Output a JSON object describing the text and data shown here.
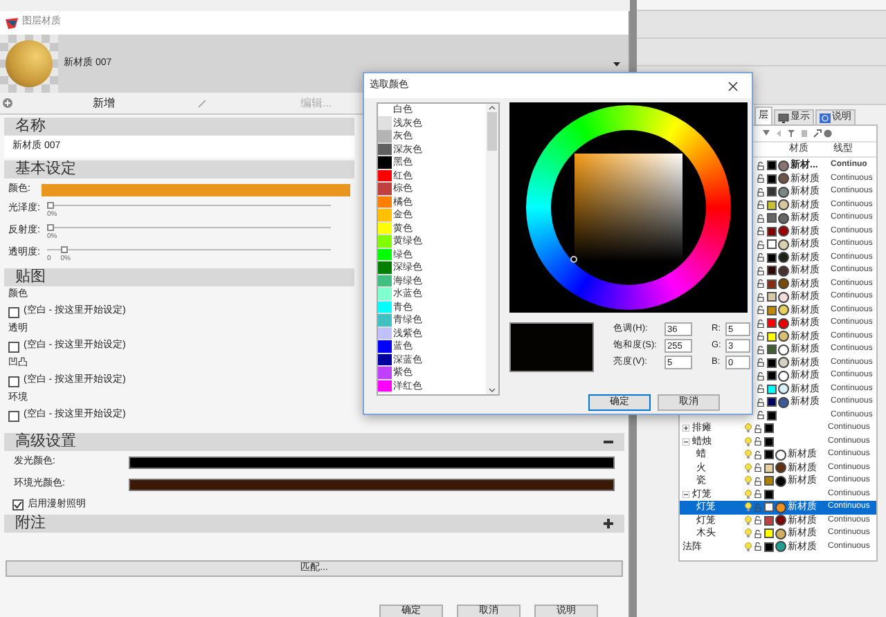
{
  "material_window": {
    "title": "图层材质",
    "material_name": "新材质 007",
    "toolbar": {
      "new": "新增",
      "edit": "编辑..."
    },
    "name_section": {
      "title": "名称",
      "value": "新材质 007"
    },
    "basic": {
      "title": "基本设定",
      "color_rows": [
        {
          "label": "颜色:",
          "color": "#e8961e"
        }
      ],
      "sliders": [
        {
          "label": "光泽度:",
          "level": 0,
          "reading": "0%"
        },
        {
          "label": "反射度:",
          "level": 0,
          "reading": "0%"
        },
        {
          "label": "透明度:",
          "level": 0.05,
          "reading": "0%",
          "min_label": "0"
        }
      ]
    },
    "textures": {
      "title": "贴图",
      "slots": [
        {
          "label": "颜色",
          "checked": false,
          "text": "(空白 - 按这里开始设定)"
        },
        {
          "label": "透明",
          "checked": false,
          "text": "(空白 - 按这里开始设定)"
        },
        {
          "label": "凹凸",
          "checked": false,
          "text": "(空白 - 按这里开始设定)"
        },
        {
          "label": "环境",
          "checked": false,
          "text": "(空白 - 按这里开始设定)"
        }
      ]
    },
    "advanced": {
      "title": "高级设置",
      "expanded": true,
      "color_rows": [
        {
          "label": "发光颜色:",
          "color": "#000000"
        },
        {
          "label": "环境光颜色:",
          "color": "#3a1a06"
        }
      ],
      "diffuse": {
        "label": "启用漫射照明",
        "checked": true
      }
    },
    "notes": {
      "title": "附注",
      "expanded": false
    },
    "match_button": "匹配...",
    "buttons": [
      "确定",
      "取消",
      "说明"
    ]
  },
  "color_dialog": {
    "title": "选取颜色",
    "swatches": [
      {
        "name": "白色",
        "color": "#ffffff"
      },
      {
        "name": "浅灰色",
        "color": "#e0e0e0"
      },
      {
        "name": "灰色",
        "color": "#b4b4b4"
      },
      {
        "name": "深灰色",
        "color": "#606060"
      },
      {
        "name": "黑色",
        "color": "#000000"
      },
      {
        "name": "红色",
        "color": "#ff0000"
      },
      {
        "name": "棕色",
        "color": "#c04040"
      },
      {
        "name": "橘色",
        "color": "#ff8000"
      },
      {
        "name": "金色",
        "color": "#ffc000"
      },
      {
        "name": "黄色",
        "color": "#ffff00"
      },
      {
        "name": "黄绿色",
        "color": "#80ff00"
      },
      {
        "name": "绿色",
        "color": "#00ff00"
      },
      {
        "name": "深绿色",
        "color": "#008000"
      },
      {
        "name": "海绿色",
        "color": "#40c080"
      },
      {
        "name": "水蓝色",
        "color": "#80ffd0"
      },
      {
        "name": "青色",
        "color": "#00ffff"
      },
      {
        "name": "青绿色",
        "color": "#40c0c0"
      },
      {
        "name": "浅紫色",
        "color": "#c0c0ff"
      },
      {
        "name": "蓝色",
        "color": "#0000ff"
      },
      {
        "name": "深蓝色",
        "color": "#0000a0"
      },
      {
        "name": "紫色",
        "color": "#c040ff"
      },
      {
        "name": "洋红色",
        "color": "#ff00ff"
      }
    ],
    "hsv": [
      {
        "label": "色调(H):",
        "value": "36"
      },
      {
        "label": "饱和度(S):",
        "value": "255"
      },
      {
        "label": "亮度(V):",
        "value": "5"
      }
    ],
    "rgb": [
      {
        "label": "R:",
        "value": "5"
      },
      {
        "label": "G:",
        "value": "3"
      },
      {
        "label": "B:",
        "value": "0"
      }
    ],
    "buttons": [
      {
        "label": "确定",
        "focused": true
      },
      {
        "label": "取消",
        "focused": false
      }
    ]
  },
  "layer_panel": {
    "tabs": [
      {
        "label": "层",
        "selected": true
      },
      {
        "label": "显示",
        "selected": false
      },
      {
        "label": "说明",
        "selected": false
      }
    ],
    "columns": [
      "材质",
      "线型"
    ],
    "layers": [
      {
        "color": "#000000",
        "material": {
          "name": "新材...",
          "color": "#8a7470"
        },
        "linetype": "Continuo",
        "current": true,
        "selected": false
      },
      {
        "color": "#000000",
        "material": {
          "name": "新材质",
          "color": "#6e5444"
        },
        "linetype": "Continuous",
        "current": false,
        "selected": false
      },
      {
        "color": "#333333",
        "material": {
          "name": "新材质",
          "color": "#788886"
        },
        "linetype": "Continuous",
        "current": false,
        "selected": false
      },
      {
        "color": "#c8c030",
        "material": {
          "name": "新材质",
          "color": "#d8c8a0"
        },
        "linetype": "Continuous",
        "current": false,
        "selected": false
      },
      {
        "color": "#666666",
        "material": {
          "name": "新材质",
          "color": "#666666"
        },
        "linetype": "Continuous",
        "current": false,
        "selected": false
      },
      {
        "color": "#800000",
        "material": {
          "name": "新材质",
          "color": "#a00000"
        },
        "linetype": "Continuous",
        "current": false,
        "selected": false
      },
      {
        "color": "#ffffff",
        "material": {
          "name": "新材质",
          "color": "#d8d0b0"
        },
        "linetype": "Continuous",
        "current": false,
        "selected": false
      },
      {
        "color": "#000000",
        "material": {
          "name": "新材质",
          "color": "#1c2414"
        },
        "linetype": "Continuous",
        "current": false,
        "selected": false
      },
      {
        "color": "#300808",
        "material": {
          "name": "新材质",
          "color": "#4a3030"
        },
        "linetype": "Continuous",
        "current": false,
        "selected": false
      },
      {
        "color": "#8a2a10",
        "material": {
          "name": "新材质",
          "color": "#7a4a00"
        },
        "linetype": "Continuous",
        "current": false,
        "selected": false
      },
      {
        "color": "#d8c8a8",
        "material": {
          "name": "新材质",
          "color": "#f4dcdc"
        },
        "linetype": "Continuous",
        "current": false,
        "selected": false
      },
      {
        "color": "#c08800",
        "material": {
          "name": "新材质",
          "color": "#e8d060"
        },
        "linetype": "Continuous",
        "current": false,
        "selected": false
      },
      {
        "color": "#ff0000",
        "material": {
          "name": "新材质",
          "color": "#ee0000"
        },
        "linetype": "Continuous",
        "current": false,
        "selected": false
      },
      {
        "color": "#ffff00",
        "material": {
          "name": "新材质",
          "color": "#d8c070"
        },
        "linetype": "Continuous",
        "current": false,
        "selected": false
      },
      {
        "color": "#406030",
        "material": {
          "name": "新材质",
          "color": "#ffffff"
        },
        "linetype": "Continuous",
        "current": false,
        "selected": false
      },
      {
        "color": "#000000",
        "material": {
          "name": "新材质",
          "color": "#d8d0c0"
        },
        "linetype": "Continuous",
        "current": false,
        "selected": false
      },
      {
        "color": "#000000",
        "material": {
          "name": "新材质",
          "color": "#ffffff"
        },
        "linetype": "Continuous",
        "current": false,
        "selected": false
      },
      {
        "color": "#00ffff",
        "material": {
          "name": "新材质",
          "color": "#d8f0f8"
        },
        "linetype": "Continuous",
        "current": false,
        "selected": false
      },
      {
        "color": "#000060",
        "material": {
          "name": "新材质",
          "color": "#3a5a9a"
        },
        "linetype": "Continuous",
        "current": false,
        "selected": false
      },
      {
        "color": "#000000",
        "linetype": "Continuous",
        "current": false,
        "selected": false
      },
      {
        "name": "排瘫",
        "expanded": false,
        "color": "#000000",
        "linetype": "Continuous",
        "current": false,
        "selected": false
      },
      {
        "name": "蜡烛",
        "expanded": true,
        "color": "#000000",
        "linetype": "Continuous",
        "current": false,
        "selected": false,
        "children": [
          {
            "name": "蜡",
            "color": "#000000",
            "material": {
              "name": "新材质",
              "color": "#ffffff"
            },
            "linetype": "Continuous",
            "current": false,
            "selected": false
          },
          {
            "name": "火",
            "color": "#e8d0a0",
            "material": {
              "name": "新材质",
              "color": "#603010"
            },
            "linetype": "Continuous",
            "current": false,
            "selected": false
          },
          {
            "name": "瓷",
            "color": "#b08000",
            "material": {
              "name": "新材质",
              "color": "#000000"
            },
            "linetype": "Continuous",
            "current": false,
            "selected": false
          }
        ]
      },
      {
        "name": "灯笼",
        "expanded": true,
        "color": "#000000",
        "linetype": "Continuous",
        "current": false,
        "selected": false,
        "children": [
          {
            "name": "灯笼",
            "color": "#ffffff",
            "material": {
              "name": "新材质",
              "color": "#f09020"
            },
            "linetype": "Continuous",
            "current": false,
            "selected": true
          },
          {
            "name": "灯笼",
            "color": "#c04040",
            "material": {
              "name": "新材质",
              "color": "#800000"
            },
            "linetype": "Continuous",
            "current": false,
            "selected": false
          },
          {
            "name": "木头",
            "color": "#ffff00",
            "material": {
              "name": "新材质",
              "color": "#d0b060"
            },
            "linetype": "Continuous",
            "current": false,
            "selected": false
          }
        ]
      },
      {
        "name": "法阵",
        "color": "#000000",
        "material": {
          "name": "新材质",
          "color": "#20a090"
        },
        "linetype": "Continuous",
        "current": false,
        "selected": false
      }
    ]
  }
}
